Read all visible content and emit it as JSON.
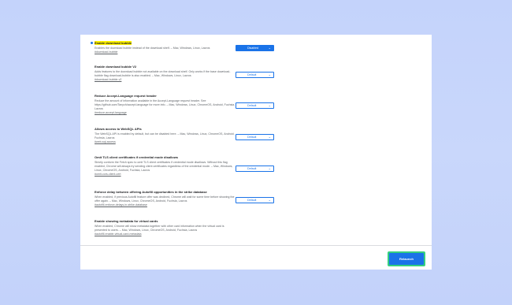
{
  "flags": [
    {
      "title": "Enable download bubble",
      "description": "Enables the download bubble instead of the download shelf. – Mac, Windows, Linux, Lacros",
      "link": "#download-bubble",
      "value": "Disabled",
      "highlighted": true
    },
    {
      "title": "Enable download bubble V2",
      "description": "Adds features to the download bubble not available on the download shelf. Only works if the base download-bubble flag download-bubble is also enabled. – Mac, Windows, Linux, Lacros",
      "link": "#download-bubble-v2",
      "value": "Default"
    },
    {
      "title": "Reduce Accept-Language request header",
      "description": "Reduce the amount of information available in the Accept-Language request header. See https://github.com/Tanych/accept-language for more info. – Mac, Windows, Linux, ChromeOS, Android, Fuchsia, Lacros",
      "link": "#reduce-accept-language",
      "value": "Default"
    },
    {
      "title": "Allows access to WebSQL APIs",
      "description": "The WebSQL API is enabled by default, but can be disabled here. – Mac, Windows, Linux, ChromeOS, Android, Fuchsia, Lacros",
      "link": "#web-sql-access",
      "value": "Default"
    },
    {
      "title": "Omit TLS client certificates if credential mode disallows",
      "description": "Strictly conform the Fetch spec to omit TLS client certificates if credential mode disallows. Without this flag enabled, Chrome will always try sending client certificates regardless of the credential mode. – Mac, Windows, Linux, ChromeOS, Android, Fuchsia, Lacros",
      "link": "#omit-cors-client-cert",
      "value": "Default"
    },
    {
      "title": "Enforce delay between offering Autofill opportunities in the strike database",
      "description": "When enabled, if previous Autofill feature offer was declined, Chrome will wait for some time before showing the offer again. – Mac, Windows, Linux, ChromeOS, Android, Fuchsia, Lacros",
      "link": "#autofill-enforce-delays-in-strike-database",
      "value": "Default"
    },
    {
      "title": "Enable showing metadata for virtual cards",
      "description": "When enabled, Chrome will show metadata together with other card information when the virtual card is presented to users. – Mac, Windows, Linux, ChromeOS, Android, Fuchsia, Lacros",
      "link": "#autofill-enable-virtual-card-metadata",
      "value": ""
    }
  ],
  "relaunch_label": "Relaunch",
  "colors": {
    "accent": "#1a73e8",
    "highlight": "#fff200",
    "focus_ring": "#35d07f"
  }
}
